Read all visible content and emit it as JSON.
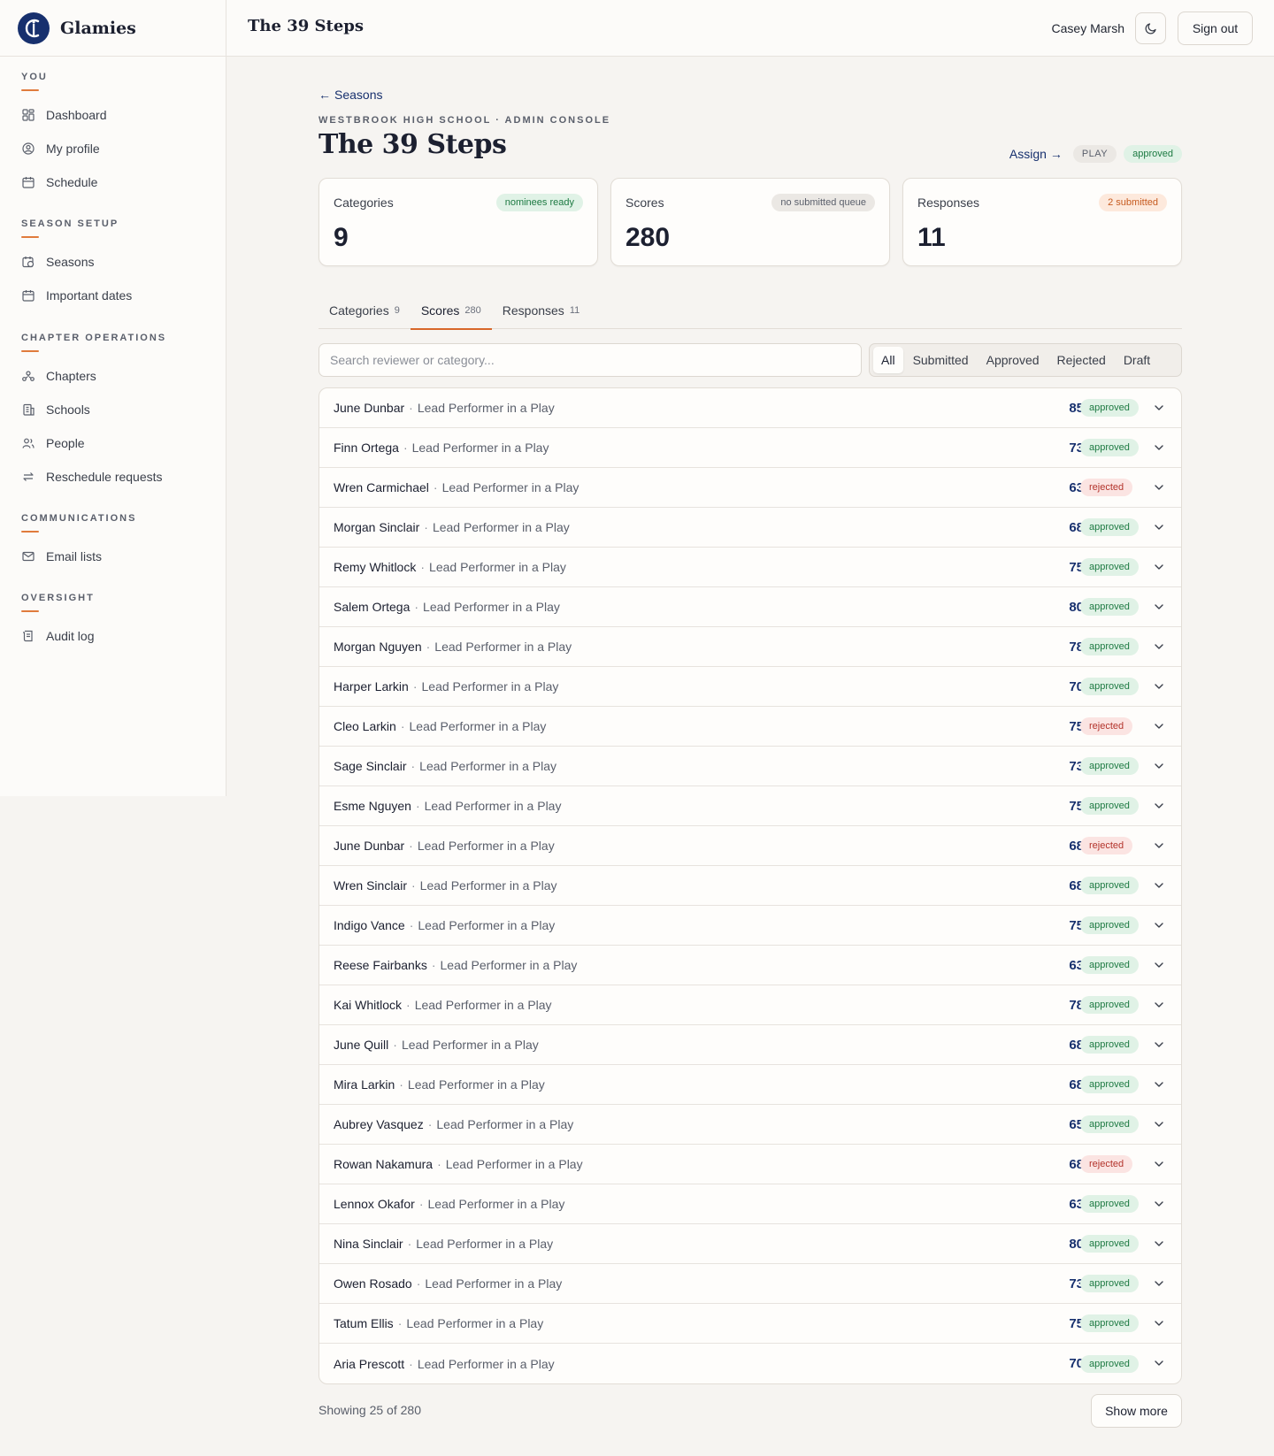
{
  "app": {
    "name": "Glamies"
  },
  "header": {
    "title": "The 39 Steps",
    "user_name": "Casey Marsh",
    "signout_label": "Sign out"
  },
  "sidebar": {
    "sections": [
      {
        "heading": "YOU",
        "items": [
          {
            "label": "Dashboard",
            "icon": "dashboard-icon"
          },
          {
            "label": "My profile",
            "icon": "profile-icon"
          },
          {
            "label": "Schedule",
            "icon": "calendar-icon"
          }
        ]
      },
      {
        "heading": "SEASON SETUP",
        "items": [
          {
            "label": "Seasons",
            "icon": "calendar-clock-icon"
          },
          {
            "label": "Important dates",
            "icon": "calendar-icon"
          }
        ]
      },
      {
        "heading": "CHAPTER OPERATIONS",
        "items": [
          {
            "label": "Chapters",
            "icon": "network-icon"
          },
          {
            "label": "Schools",
            "icon": "building-icon"
          },
          {
            "label": "People",
            "icon": "people-icon"
          },
          {
            "label": "Reschedule requests",
            "icon": "swap-icon"
          }
        ]
      },
      {
        "heading": "COMMUNICATIONS",
        "items": [
          {
            "label": "Email lists",
            "icon": "mail-icon"
          }
        ]
      },
      {
        "heading": "OVERSIGHT",
        "items": [
          {
            "label": "Audit log",
            "icon": "scroll-icon"
          }
        ]
      }
    ]
  },
  "main": {
    "back_label": "Seasons",
    "eyebrow": "WESTBROOK HIGH SCHOOL · ADMIN CONSOLE",
    "title": "The 39 Steps",
    "assign_label": "Assign",
    "type_badge": "PLAY",
    "status_badge": "approved",
    "cards": [
      {
        "label": "Categories",
        "badge": "nominees ready",
        "value": "9"
      },
      {
        "label": "Scores",
        "badge": "no submitted queue",
        "value": "280"
      },
      {
        "label": "Responses",
        "badge": "2 submitted",
        "value": "11"
      }
    ],
    "tabs": [
      {
        "label": "Categories",
        "count": "9"
      },
      {
        "label": "Scores",
        "count": "280"
      },
      {
        "label": "Responses",
        "count": "11"
      }
    ],
    "search_placeholder": "Search reviewer or category...",
    "filters": [
      "All",
      "Submitted",
      "Approved",
      "Rejected",
      "Draft"
    ],
    "rows": [
      {
        "reviewer": "June Dunbar",
        "category": "Lead Performer in a Play",
        "score": "85",
        "status": "approved"
      },
      {
        "reviewer": "Finn Ortega",
        "category": "Lead Performer in a Play",
        "score": "73",
        "status": "approved"
      },
      {
        "reviewer": "Wren Carmichael",
        "category": "Lead Performer in a Play",
        "score": "63",
        "status": "rejected"
      },
      {
        "reviewer": "Morgan Sinclair",
        "category": "Lead Performer in a Play",
        "score": "68",
        "status": "approved"
      },
      {
        "reviewer": "Remy Whitlock",
        "category": "Lead Performer in a Play",
        "score": "75",
        "status": "approved"
      },
      {
        "reviewer": "Salem Ortega",
        "category": "Lead Performer in a Play",
        "score": "80",
        "status": "approved"
      },
      {
        "reviewer": "Morgan Nguyen",
        "category": "Lead Performer in a Play",
        "score": "78",
        "status": "approved"
      },
      {
        "reviewer": "Harper Larkin",
        "category": "Lead Performer in a Play",
        "score": "70",
        "status": "approved"
      },
      {
        "reviewer": "Cleo Larkin",
        "category": "Lead Performer in a Play",
        "score": "75",
        "status": "rejected"
      },
      {
        "reviewer": "Sage Sinclair",
        "category": "Lead Performer in a Play",
        "score": "73",
        "status": "approved"
      },
      {
        "reviewer": "Esme Nguyen",
        "category": "Lead Performer in a Play",
        "score": "75",
        "status": "approved"
      },
      {
        "reviewer": "June Dunbar",
        "category": "Lead Performer in a Play",
        "score": "68",
        "status": "rejected"
      },
      {
        "reviewer": "Wren Sinclair",
        "category": "Lead Performer in a Play",
        "score": "68",
        "status": "approved"
      },
      {
        "reviewer": "Indigo Vance",
        "category": "Lead Performer in a Play",
        "score": "75",
        "status": "approved"
      },
      {
        "reviewer": "Reese Fairbanks",
        "category": "Lead Performer in a Play",
        "score": "63",
        "status": "approved"
      },
      {
        "reviewer": "Kai Whitlock",
        "category": "Lead Performer in a Play",
        "score": "78",
        "status": "approved"
      },
      {
        "reviewer": "June Quill",
        "category": "Lead Performer in a Play",
        "score": "68",
        "status": "approved"
      },
      {
        "reviewer": "Mira Larkin",
        "category": "Lead Performer in a Play",
        "score": "68",
        "status": "approved"
      },
      {
        "reviewer": "Aubrey Vasquez",
        "category": "Lead Performer in a Play",
        "score": "65",
        "status": "approved"
      },
      {
        "reviewer": "Rowan Nakamura",
        "category": "Lead Performer in a Play",
        "score": "68",
        "status": "rejected"
      },
      {
        "reviewer": "Lennox Okafor",
        "category": "Lead Performer in a Play",
        "score": "63",
        "status": "approved"
      },
      {
        "reviewer": "Nina Sinclair",
        "category": "Lead Performer in a Play",
        "score": "80",
        "status": "approved"
      },
      {
        "reviewer": "Owen Rosado",
        "category": "Lead Performer in a Play",
        "score": "73",
        "status": "approved"
      },
      {
        "reviewer": "Tatum Ellis",
        "category": "Lead Performer in a Play",
        "score": "75",
        "status": "approved"
      },
      {
        "reviewer": "Aria Prescott",
        "category": "Lead Performer in a Play",
        "score": "70",
        "status": "approved"
      }
    ],
    "footer_count": "Showing 25 of 280",
    "show_more_label": "Show more"
  },
  "colors": {
    "accent": "#d8672a",
    "brand": "#17306e",
    "approved": "#1d7a42",
    "rejected": "#b3332b"
  }
}
